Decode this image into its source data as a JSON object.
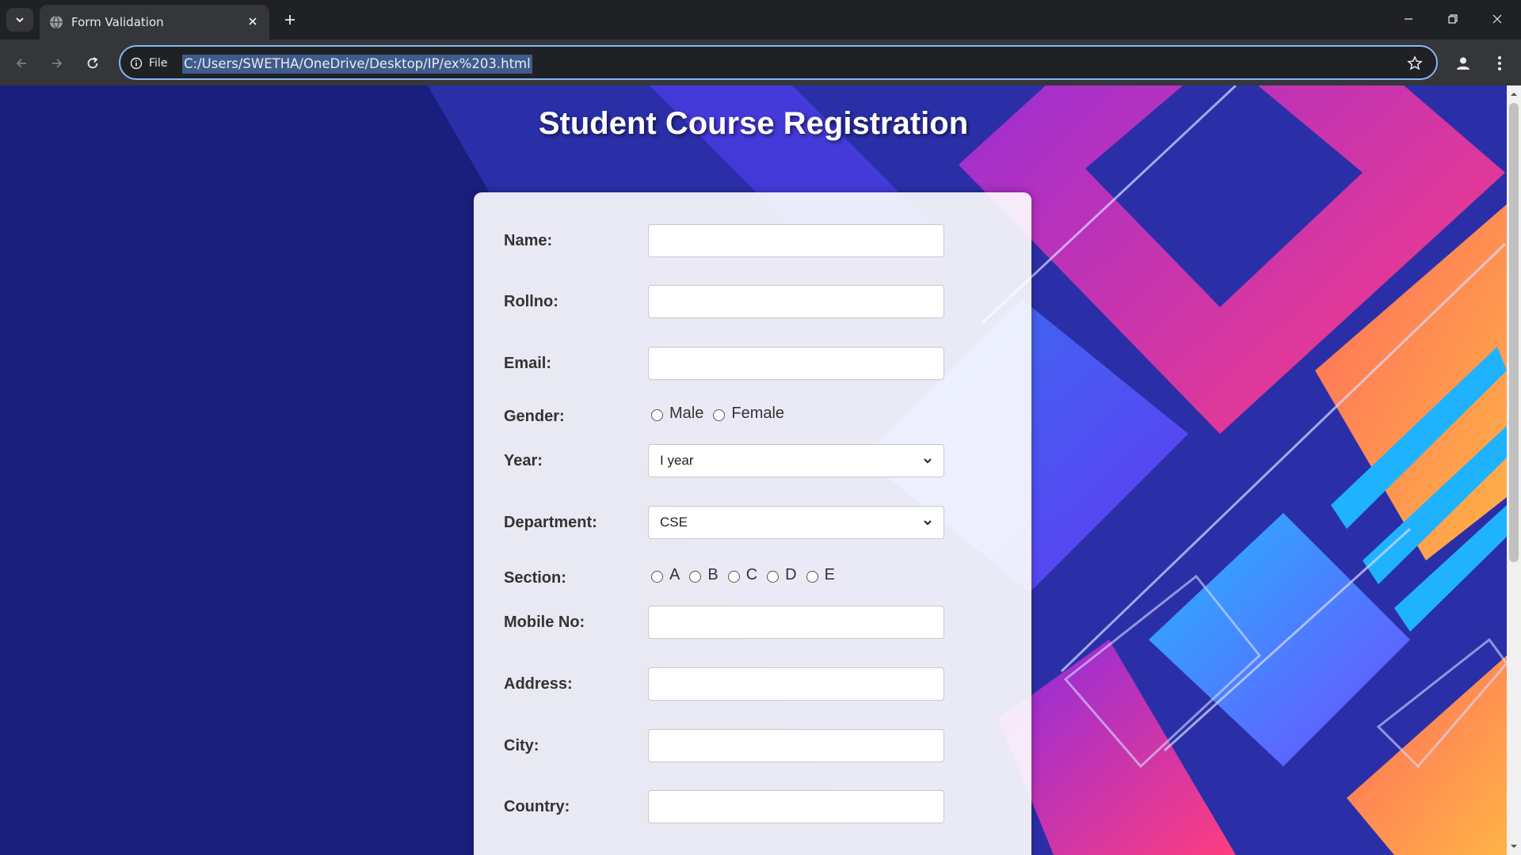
{
  "browser": {
    "tab_title": "Form Validation",
    "url": "C:/Users/SWETHA/OneDrive/Desktop/IP/ex%203.html",
    "info_chip_label": "File",
    "accent": "#8ab4f8"
  },
  "page": {
    "title": "Student Course Registration",
    "background_color": "#1a1f7d"
  },
  "form": {
    "name": {
      "label": "Name:",
      "value": ""
    },
    "rollno": {
      "label": "Rollno:",
      "value": ""
    },
    "email": {
      "label": "Email:",
      "value": ""
    },
    "gender": {
      "label": "Gender:",
      "options": [
        "Male",
        "Female"
      ]
    },
    "year": {
      "label": "Year:",
      "selected": "I year"
    },
    "department": {
      "label": "Department:",
      "selected": "CSE"
    },
    "section": {
      "label": "Section:",
      "options": [
        "A",
        "B",
        "C",
        "D",
        "E"
      ]
    },
    "mobile": {
      "label": "Mobile No:",
      "value": ""
    },
    "address": {
      "label": "Address:",
      "value": ""
    },
    "city": {
      "label": "City:",
      "value": ""
    },
    "country": {
      "label": "Country:",
      "value": ""
    }
  },
  "icons": [
    "tab-search-icon",
    "globe-icon",
    "close-icon",
    "plus-icon",
    "minimize-icon",
    "restore-icon",
    "window-close-icon",
    "back-icon",
    "forward-icon",
    "reload-icon",
    "info-icon",
    "star-icon",
    "profile-icon",
    "kebab-menu-icon",
    "chevron-down-icon"
  ]
}
